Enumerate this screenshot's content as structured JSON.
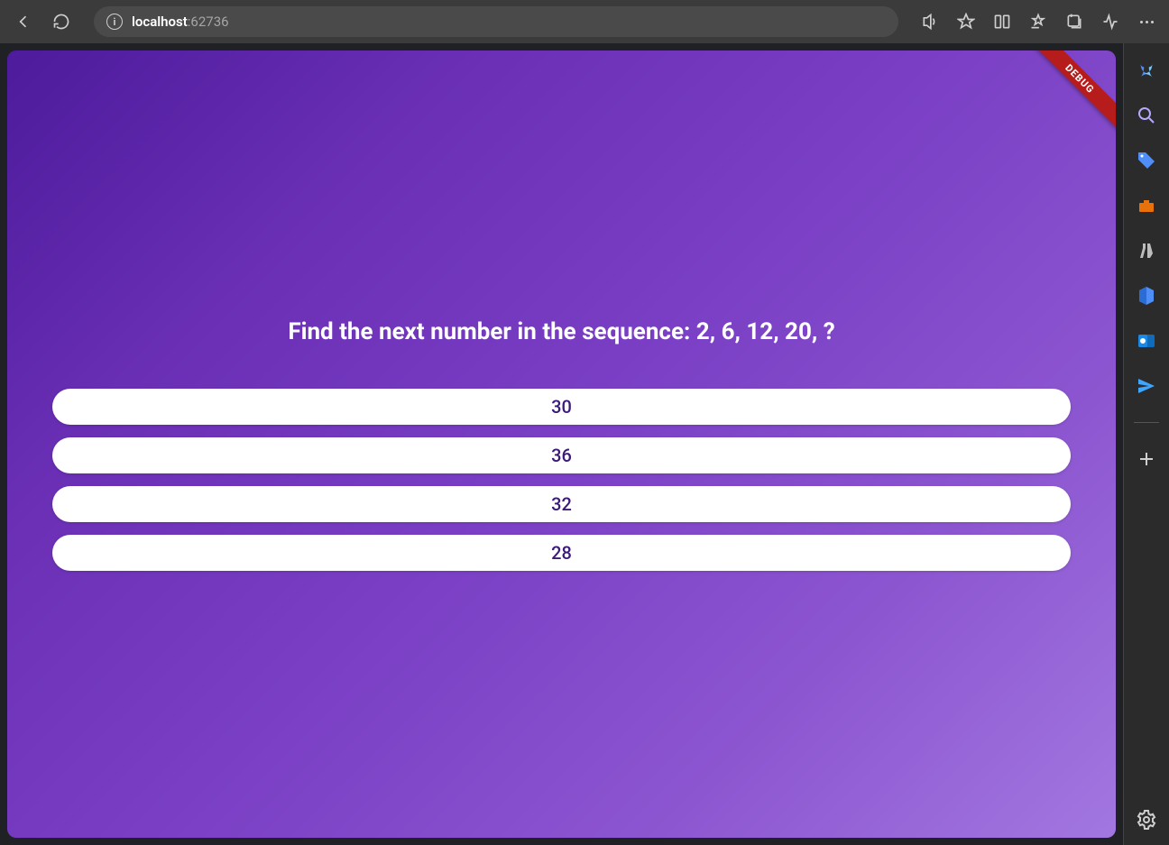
{
  "browser": {
    "url_host": "localhost",
    "url_port": ":62736"
  },
  "debug_label": "DEBUG",
  "quiz": {
    "question": "Find the next number in the sequence: 2, 6, 12, 20, ?",
    "options": [
      "30",
      "36",
      "32",
      "28"
    ]
  }
}
